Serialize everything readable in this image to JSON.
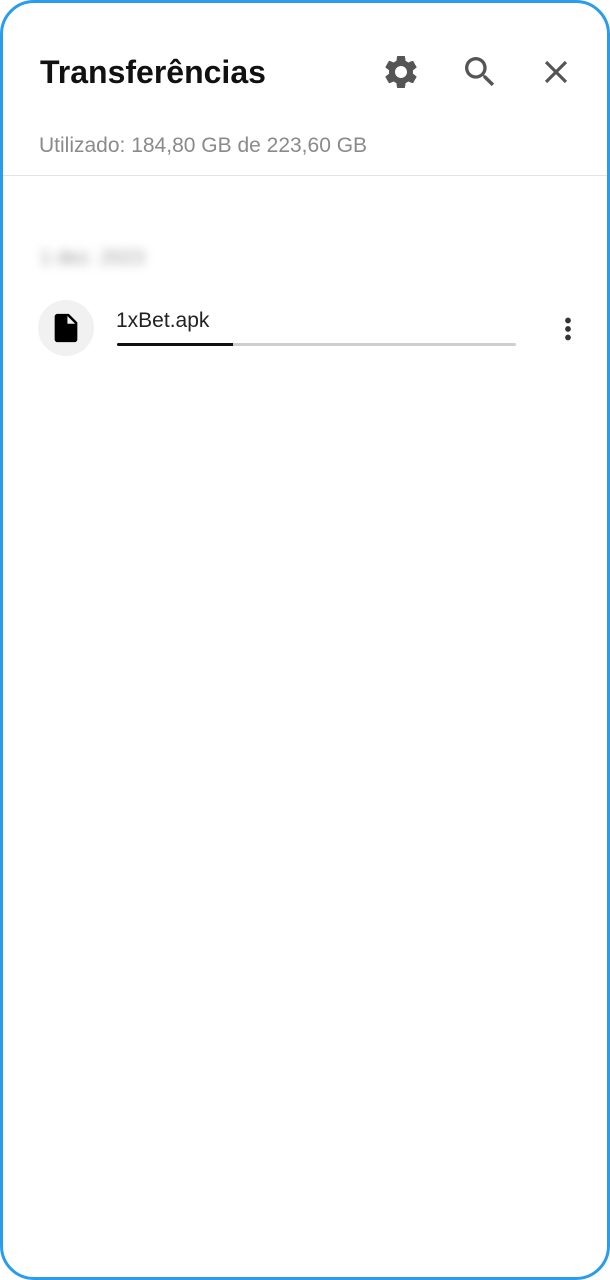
{
  "header": {
    "title": "Transferências",
    "icons": {
      "settings": "gear-icon",
      "search": "search-icon",
      "close": "close-icon"
    }
  },
  "storage": {
    "text": "Utilizado: 184,80 GB de 223,60 GB"
  },
  "downloads": {
    "group_date": "1 dez. 2023",
    "items": [
      {
        "name": "1xBet.apk",
        "icon": "file-icon",
        "progress": 0.29
      }
    ]
  },
  "colors": {
    "frame_border": "#2b9cec",
    "icon_gray": "#555555",
    "progress_fill": "#111111",
    "progress_track": "#cfcfcf"
  }
}
